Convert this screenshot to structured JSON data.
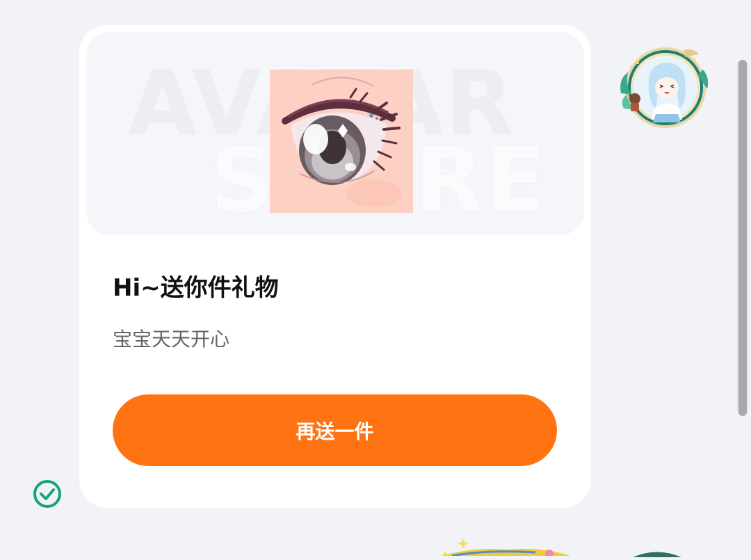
{
  "gift_card": {
    "watermark": {
      "line1": "AVATAR",
      "line2": "STORE"
    },
    "title": "Hi~送你件礼物",
    "message": "宝宝天天开心",
    "send_again_label": "再送一件"
  },
  "icons": {
    "gift_image": "anime-eye-image",
    "check": "check-circle-icon",
    "avatar": "anime-avatar-frame"
  },
  "colors": {
    "accent": "#ff7313",
    "check": "#16a37a",
    "background": "#f2f3f7",
    "card": "#ffffff"
  }
}
